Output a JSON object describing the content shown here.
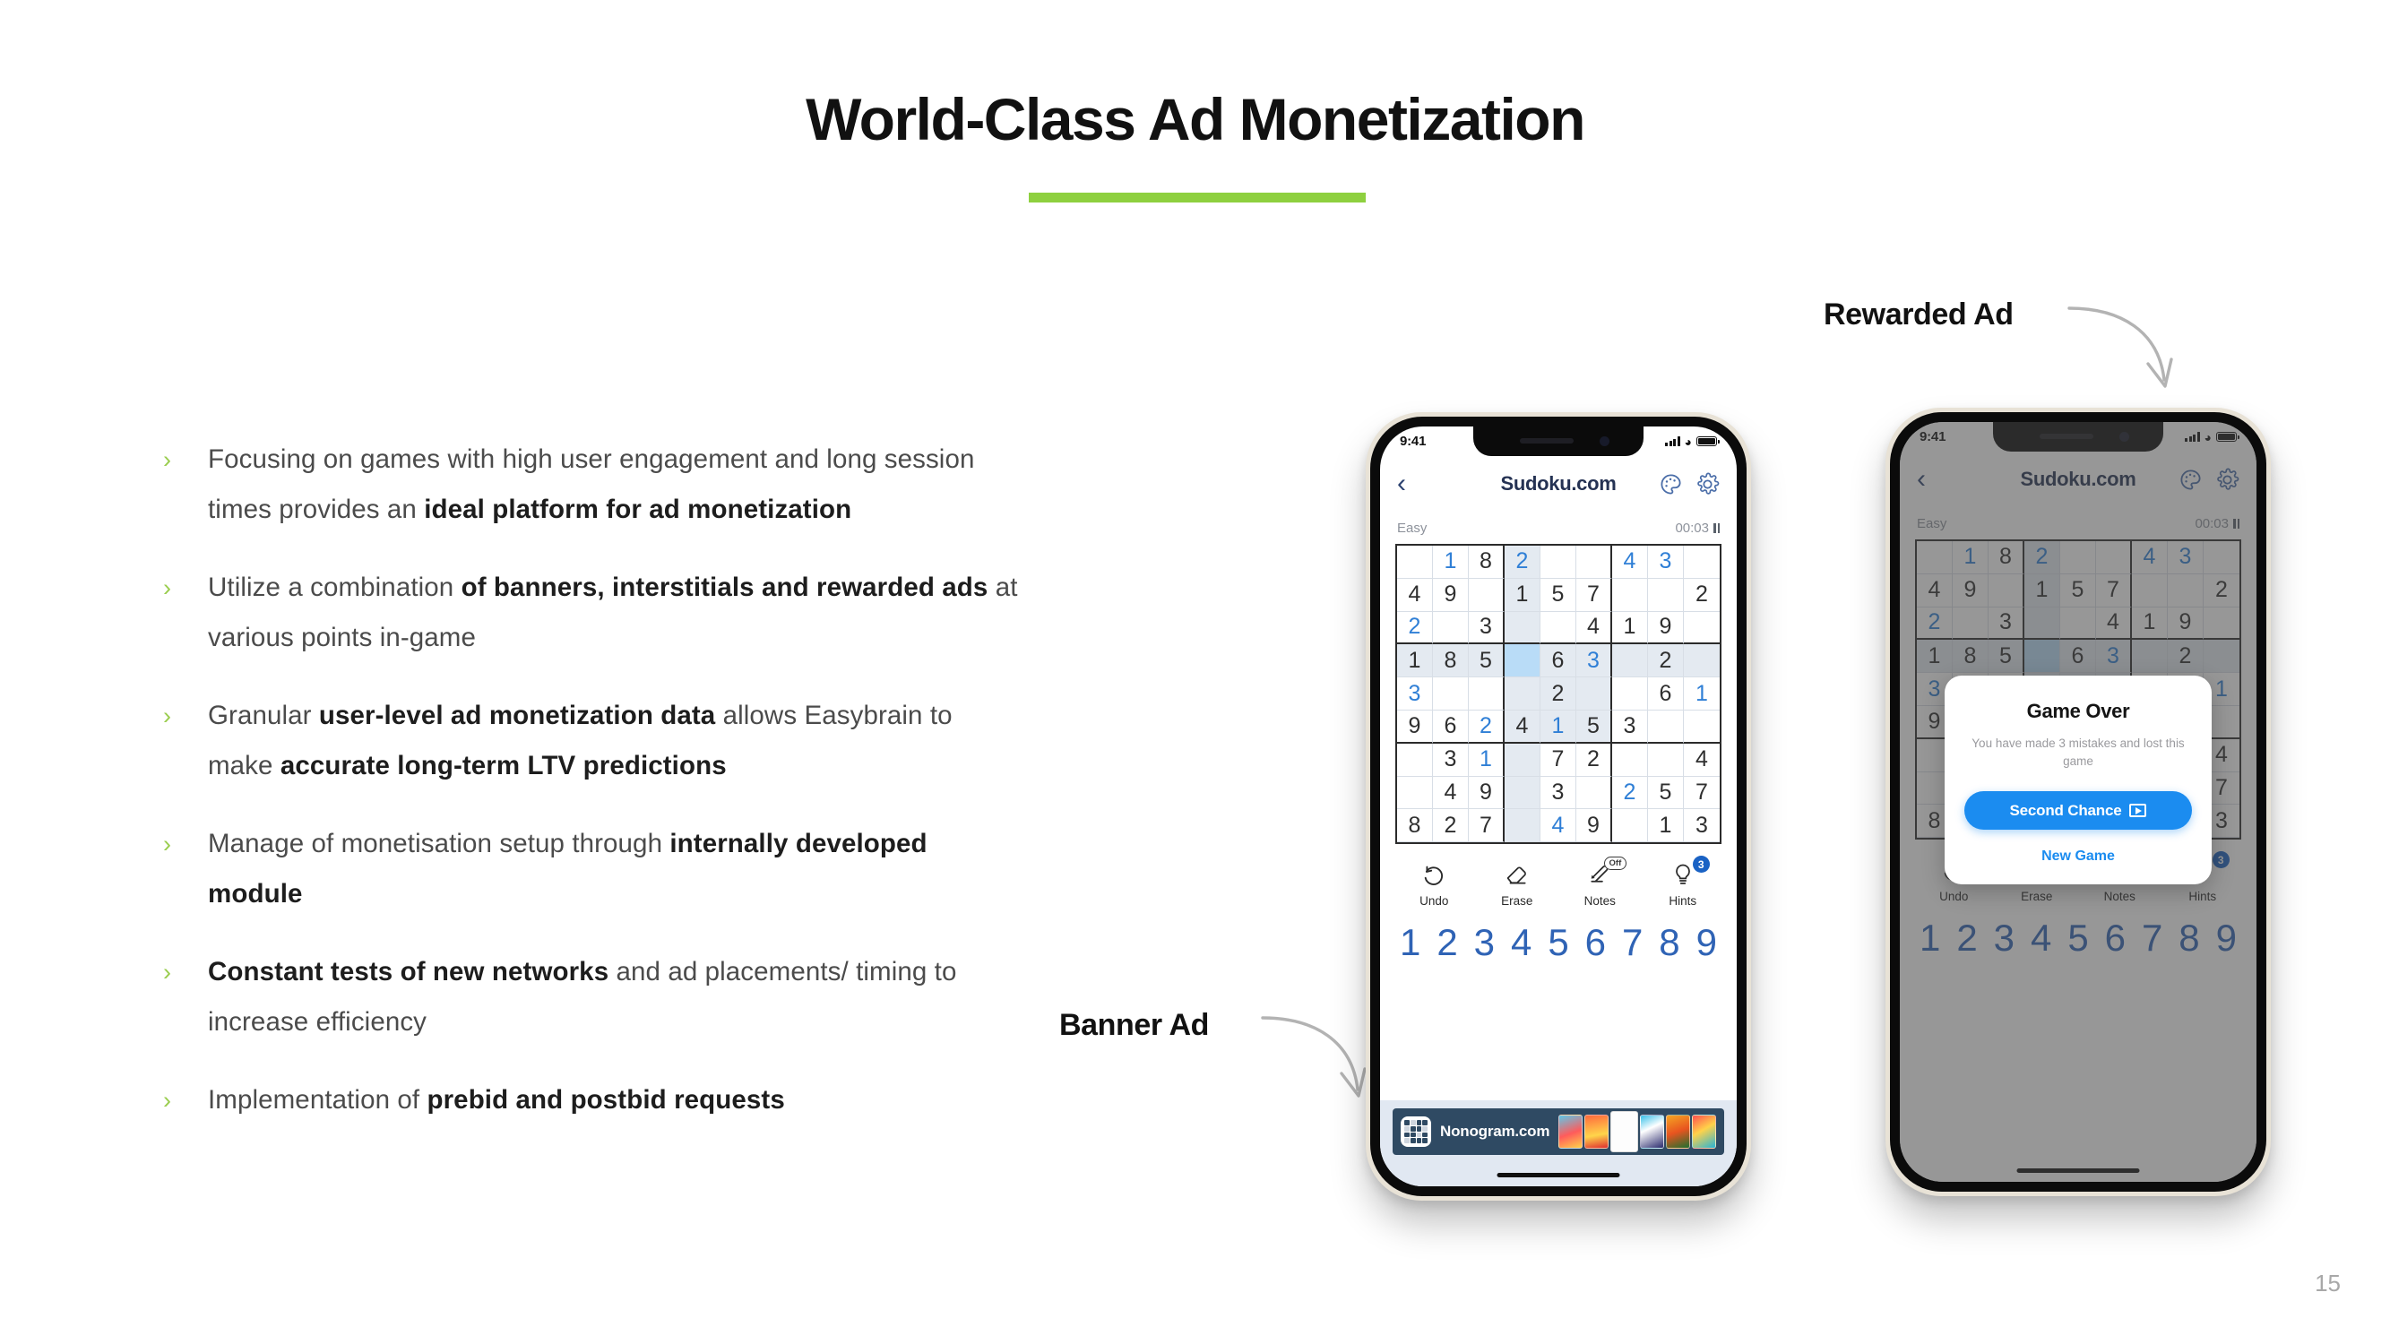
{
  "slide": {
    "title": "World-Class Ad Monetization",
    "page_number": "15",
    "accent_color": "#8ed03f",
    "bullet_marker": "›"
  },
  "bullets": [
    {
      "id": "bullet-1",
      "parts": [
        {
          "t": "Focusing on games with high user engagement and long session times provides an ",
          "b": false
        },
        {
          "t": "ideal platform for ad monetization",
          "b": true
        }
      ]
    },
    {
      "id": "bullet-2",
      "parts": [
        {
          "t": "Utilize a combination ",
          "b": false
        },
        {
          "t": "of banners, interstitials and rewarded ads",
          "b": true
        },
        {
          "t": " at various points in-game",
          "b": false
        }
      ]
    },
    {
      "id": "bullet-3",
      "parts": [
        {
          "t": "Granular ",
          "b": false
        },
        {
          "t": "user-level ad monetization data",
          "b": true
        },
        {
          "t": " allows Easybrain to make ",
          "b": false
        },
        {
          "t": "accurate long-term LTV predictions",
          "b": true
        }
      ]
    },
    {
      "id": "bullet-4",
      "parts": [
        {
          "t": "Manage of monetisation setup through ",
          "b": false
        },
        {
          "t": "internally developed module",
          "b": true
        }
      ]
    },
    {
      "id": "bullet-5",
      "parts": [
        {
          "t": "Constant tests of new networks",
          "b": true
        },
        {
          "t": " and ad placements/ timing to increase efficiency",
          "b": false
        }
      ]
    },
    {
      "id": "bullet-6",
      "parts": [
        {
          "t": "Implementation of ",
          "b": false
        },
        {
          "t": "prebid and postbid requests",
          "b": true
        }
      ]
    }
  ],
  "callouts": {
    "rewarded": "Rewarded Ad",
    "banner": "Banner Ad"
  },
  "phone": {
    "status": {
      "time": "9:41"
    },
    "nav": {
      "back": "‹",
      "title": "Sudoku.com",
      "palette_icon": "palette-icon",
      "settings_icon": "gear-icon"
    },
    "meta": {
      "difficulty": "Easy",
      "timer": "00:03"
    },
    "toolbar": [
      {
        "label": "Undo",
        "icon": "undo-icon",
        "badge": null
      },
      {
        "label": "Erase",
        "icon": "eraser-icon",
        "badge": null
      },
      {
        "label": "Notes",
        "icon": "pencil-icon",
        "badge": "Off"
      },
      {
        "label": "Hints",
        "icon": "bulb-icon",
        "badge": "3"
      }
    ],
    "numpad": [
      "1",
      "2",
      "3",
      "4",
      "5",
      "6",
      "7",
      "8",
      "9"
    ],
    "banner_ad": {
      "title": "Nonogram.com",
      "icon": "nonogram-app-icon"
    },
    "colors": {
      "user_number": "#2f7fd6",
      "given_number": "#2f2f2f",
      "selected_cell": "#b9dcf7",
      "highlight_cell": "#e4eaf1"
    },
    "grid": [
      [
        {
          "v": "",
          "u": 0
        },
        {
          "v": "1",
          "u": 1
        },
        {
          "v": "8",
          "u": 0
        },
        {
          "v": "2",
          "u": 1,
          "h": 1
        },
        {
          "v": "",
          "u": 0
        },
        {
          "v": "",
          "u": 0
        },
        {
          "v": "4",
          "u": 1
        },
        {
          "v": "3",
          "u": 1
        },
        {
          "v": "",
          "u": 0
        }
      ],
      [
        {
          "v": "4",
          "u": 0
        },
        {
          "v": "9",
          "u": 0
        },
        {
          "v": "",
          "u": 0
        },
        {
          "v": "1",
          "u": 0,
          "h": 1
        },
        {
          "v": "5",
          "u": 0
        },
        {
          "v": "7",
          "u": 0
        },
        {
          "v": "",
          "u": 0
        },
        {
          "v": "",
          "u": 0
        },
        {
          "v": "2",
          "u": 0
        }
      ],
      [
        {
          "v": "2",
          "u": 1
        },
        {
          "v": "",
          "u": 0
        },
        {
          "v": "3",
          "u": 0
        },
        {
          "v": "",
          "u": 0,
          "h": 1
        },
        {
          "v": "",
          "u": 0
        },
        {
          "v": "4",
          "u": 0
        },
        {
          "v": "1",
          "u": 0
        },
        {
          "v": "9",
          "u": 0
        },
        {
          "v": "",
          "u": 0
        }
      ],
      [
        {
          "v": "1",
          "u": 0,
          "h": 1
        },
        {
          "v": "8",
          "u": 0,
          "h": 1
        },
        {
          "v": "5",
          "u": 0,
          "h": 1
        },
        {
          "v": "",
          "u": 0,
          "s": 1
        },
        {
          "v": "6",
          "u": 0,
          "h": 1
        },
        {
          "v": "3",
          "u": 1,
          "h": 1
        },
        {
          "v": "",
          "u": 0,
          "h": 1
        },
        {
          "v": "2",
          "u": 0,
          "h": 1
        },
        {
          "v": "",
          "u": 0,
          "h": 1
        }
      ],
      [
        {
          "v": "3",
          "u": 1
        },
        {
          "v": "",
          "u": 0
        },
        {
          "v": "",
          "u": 0
        },
        {
          "v": "",
          "u": 0,
          "h": 1
        },
        {
          "v": "2",
          "u": 0,
          "h": 1
        },
        {
          "v": "",
          "u": 0,
          "h": 1
        },
        {
          "v": "",
          "u": 0
        },
        {
          "v": "6",
          "u": 0
        },
        {
          "v": "1",
          "u": 1
        }
      ],
      [
        {
          "v": "9",
          "u": 0
        },
        {
          "v": "6",
          "u": 0
        },
        {
          "v": "2",
          "u": 1
        },
        {
          "v": "4",
          "u": 0,
          "h": 1
        },
        {
          "v": "1",
          "u": 1,
          "h": 1
        },
        {
          "v": "5",
          "u": 0,
          "h": 1
        },
        {
          "v": "3",
          "u": 0
        },
        {
          "v": "",
          "u": 0
        },
        {
          "v": "",
          "u": 0
        }
      ],
      [
        {
          "v": "",
          "u": 0
        },
        {
          "v": "3",
          "u": 0
        },
        {
          "v": "1",
          "u": 1
        },
        {
          "v": "",
          "u": 0,
          "h": 1
        },
        {
          "v": "7",
          "u": 0
        },
        {
          "v": "2",
          "u": 0
        },
        {
          "v": "",
          "u": 0
        },
        {
          "v": "",
          "u": 0
        },
        {
          "v": "4",
          "u": 0
        }
      ],
      [
        {
          "v": "",
          "u": 0
        },
        {
          "v": "4",
          "u": 0
        },
        {
          "v": "9",
          "u": 0
        },
        {
          "v": "",
          "u": 0,
          "h": 1
        },
        {
          "v": "3",
          "u": 0
        },
        {
          "v": "",
          "u": 0
        },
        {
          "v": "2",
          "u": 1
        },
        {
          "v": "5",
          "u": 0
        },
        {
          "v": "7",
          "u": 0
        }
      ],
      [
        {
          "v": "8",
          "u": 0
        },
        {
          "v": "2",
          "u": 0
        },
        {
          "v": "7",
          "u": 0
        },
        {
          "v": "",
          "u": 0,
          "h": 1
        },
        {
          "v": "4",
          "u": 1
        },
        {
          "v": "9",
          "u": 0
        },
        {
          "v": "",
          "u": 0
        },
        {
          "v": "1",
          "u": 0
        },
        {
          "v": "3",
          "u": 0
        }
      ]
    ]
  },
  "dialog": {
    "title": "Game Over",
    "body": "You have made 3 mistakes and lost this game",
    "primary_button": "Second Chance",
    "primary_icon": "video-icon",
    "secondary_link": "New Game",
    "primary_color": "#1b8cf0"
  }
}
